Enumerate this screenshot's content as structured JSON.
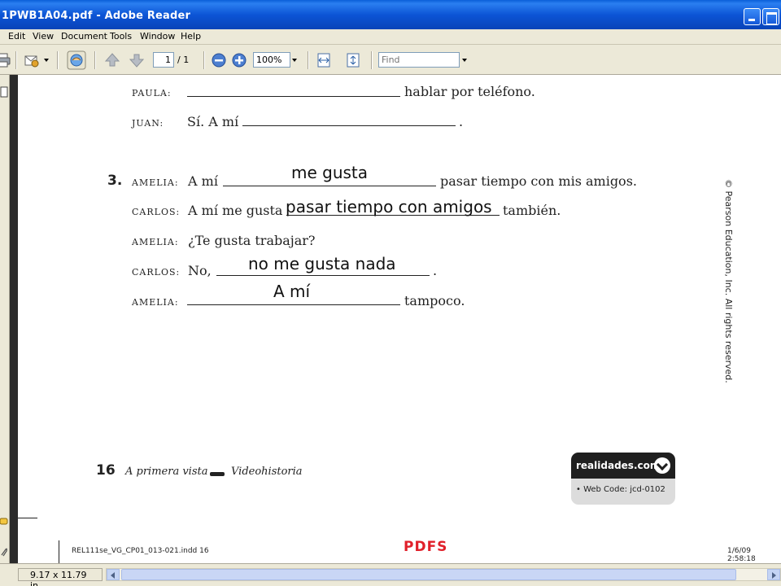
{
  "window": {
    "title": "1PWB1A04.pdf - Adobe Reader"
  },
  "menu": {
    "items": [
      "Edit",
      "View",
      "Document",
      "Tools",
      "Window",
      "Help"
    ]
  },
  "toolbar": {
    "page_current": "1",
    "page_total": "/ 1",
    "zoom": "100%",
    "find_placeholder": "Find",
    "icons": [
      "print-icon",
      "email-icon",
      "hand-tool-icon",
      "prev-page-icon",
      "next-page-icon",
      "zoom-out-icon",
      "zoom-in-icon",
      "fit-width-icon",
      "fit-page-icon"
    ]
  },
  "document": {
    "top": {
      "paula_label": "PAULA:",
      "paula_text": "hablar por teléfono.",
      "juan_label": "JUAN:",
      "juan_text": "Sí. A mí",
      "juan_end": "."
    },
    "section3": {
      "number": "3.",
      "line1_label": "AMELIA:",
      "line1_text": "A mí",
      "line1_end": "pasar tiempo con mis amigos.",
      "line1_answer": "me gusta",
      "line2_label": "CARLOS:",
      "line2_text": "A mí me gusta",
      "line2_end": "también.",
      "line2_answer": "pasar tiempo con amigos",
      "line3_label": "AMELIA:",
      "line3_text": "¿Te gusta trabajar?",
      "line4_label": "CARLOS:",
      "line4_text": "No,",
      "line4_end": ".",
      "line4_answer": "no me gusta nada",
      "line5_label": "AMELIA:",
      "line5_end": "tampoco.",
      "line5_answer": "A mí"
    },
    "copyright": "© Pearson Education, Inc. All rights reserved.",
    "footer": {
      "page_number": "16",
      "part1": "A primera vista",
      "part2": "Videohistoria"
    },
    "realidades": {
      "site": "realidades.com",
      "webcode": "• Web Code: jcd-0102"
    },
    "slug": {
      "file": "REL111se_VG_CP01_013-021.indd   16",
      "stamp": "PDFS",
      "date": "1/6/09   2:58:18"
    }
  },
  "status": {
    "page_size": "9.17 x 11.79 in"
  }
}
